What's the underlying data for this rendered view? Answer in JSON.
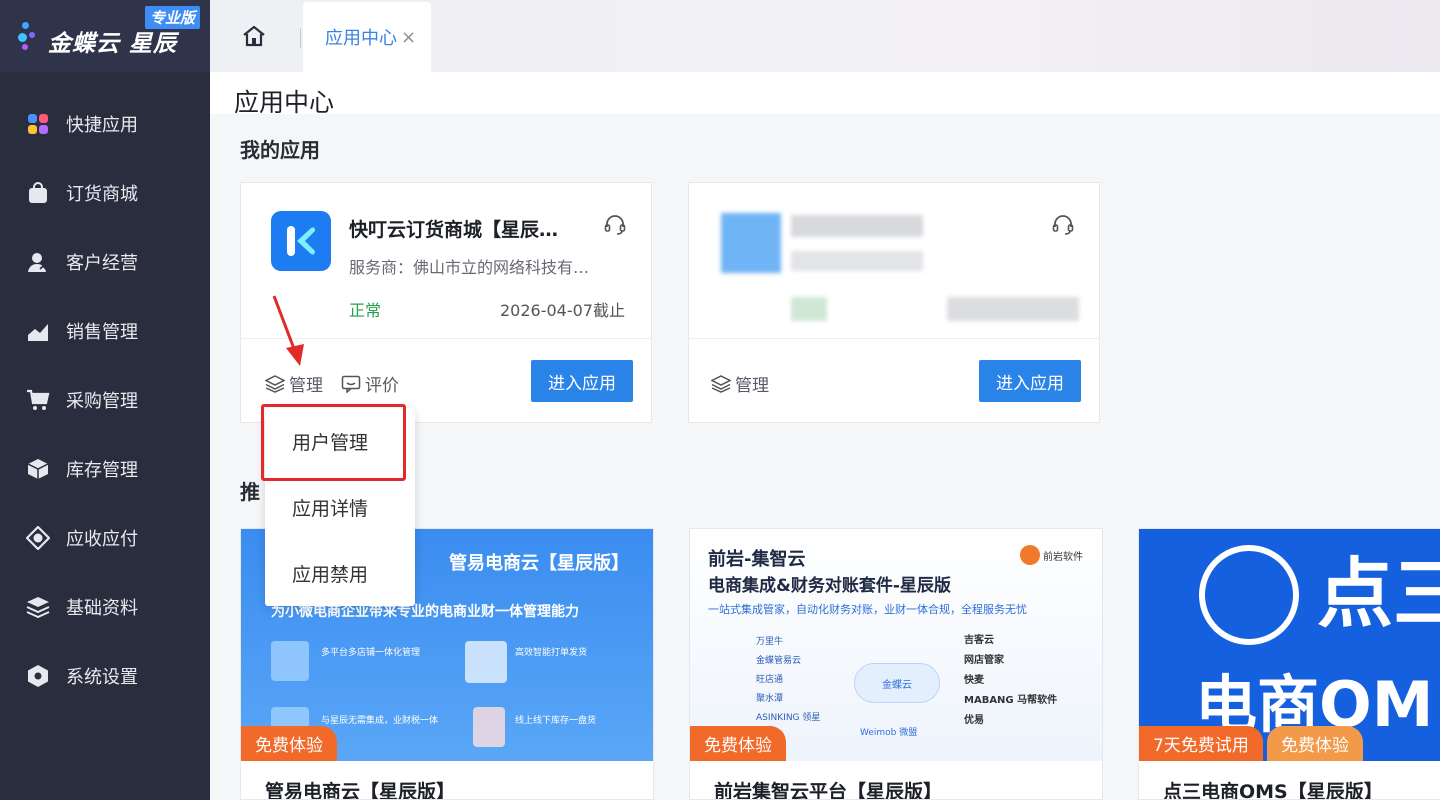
{
  "brand": {
    "logo_text": "金蝶云 星辰",
    "edition_badge": "专业版"
  },
  "sidebar": {
    "items": [
      {
        "label": "快捷应用",
        "icon": "quick-apps-icon"
      },
      {
        "label": "订货商城",
        "icon": "shopping-bag-icon"
      },
      {
        "label": "客户经营",
        "icon": "customer-icon"
      },
      {
        "label": "销售管理",
        "icon": "sales-chart-icon"
      },
      {
        "label": "采购管理",
        "icon": "cart-icon"
      },
      {
        "label": "库存管理",
        "icon": "box-icon"
      },
      {
        "label": "应收应付",
        "icon": "finance-icon"
      },
      {
        "label": "基础资料",
        "icon": "layers-icon"
      },
      {
        "label": "系统设置",
        "icon": "hexagon-settings-icon"
      }
    ]
  },
  "tabs": {
    "active_label": "应用中心",
    "close_glyph": "×"
  },
  "page": {
    "title": "应用中心",
    "my_apps_title": "我的应用",
    "recommended_title": "推"
  },
  "my_apps": [
    {
      "name": "快叮云订货商城【星辰…",
      "vendor": "服务商：佛山市立的网络科技有…",
      "status": "正常",
      "expire": "2026-04-07截止",
      "manage_label": "管理",
      "review_label": "评价",
      "enter_label": "进入应用"
    },
    {
      "manage_label": "管理",
      "enter_label": "进入应用"
    }
  ],
  "dropdown": {
    "items": [
      "用户管理",
      "应用详情",
      "应用禁用"
    ]
  },
  "recommended": [
    {
      "name": "管易电商云【星辰版】",
      "banner_title": "管易电商云【星辰版】",
      "banner_sub": "为小微电商企业带来专业的电商业财一体管理能力",
      "features": [
        "多平台多店铺一体化管理",
        "高效智能打单发货",
        "与星辰无需集成，业财税一体",
        "线上线下库存一盘货"
      ],
      "tags": [
        "免费体验"
      ]
    },
    {
      "name": "前岩集智云平台【星辰版】",
      "banner_title": "前岩-集智云",
      "banner_title2": "电商集成&财务对账套件-星辰版",
      "banner_sub": "一站式集成管家，自动化财务对账，业财一体合规，全程服务无忧",
      "vendor_logo": "前岩软件",
      "partners_left": [
        "万里牛",
        "金蝶管易云",
        "旺店通",
        "聚水潭",
        "ASINKING 领星"
      ],
      "partners_right": [
        "吉客云",
        "网店管家",
        "快麦",
        "MABANG 马帮软件",
        "优易"
      ],
      "center": "金蝶云",
      "bottom": "Weimob 微盟",
      "tags": [
        "免费体验"
      ]
    },
    {
      "name": "点三电商OMS【星辰版】",
      "banner_big": "点三",
      "banner_big2": "电商OM",
      "tags": [
        "7天免费试用",
        "免费体验"
      ]
    }
  ],
  "colors": {
    "sidebar_bg": "#2a2d3e",
    "accent": "#2a84e8",
    "status_ok": "#23a04a",
    "tag_orange": "#f16a2a",
    "highlight_red": "#e22a2a"
  }
}
